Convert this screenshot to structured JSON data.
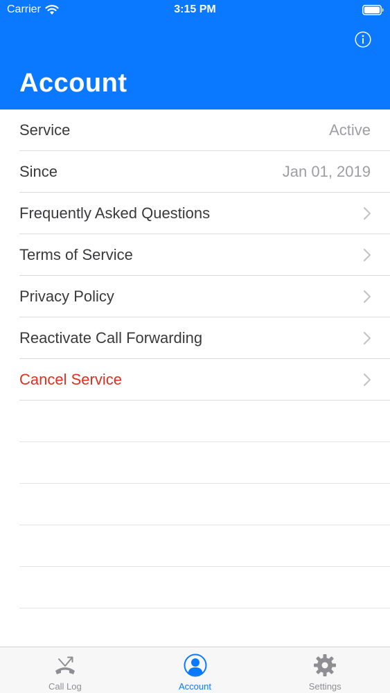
{
  "status_bar": {
    "carrier": "Carrier",
    "time": "3:15 PM"
  },
  "header": {
    "title": "Account",
    "info_icon": "info-icon"
  },
  "rows": [
    {
      "label": "Service",
      "value": "Active"
    },
    {
      "label": "Since",
      "value": "Jan 01, 2019"
    },
    {
      "label": "Frequently Asked Questions"
    },
    {
      "label": "Terms of Service"
    },
    {
      "label": "Privacy Policy"
    },
    {
      "label": "Reactivate Call Forwarding"
    },
    {
      "label": "Cancel Service"
    }
  ],
  "tabs": [
    {
      "label": "Call Log",
      "icon": "call-log-icon"
    },
    {
      "label": "Account",
      "icon": "account-icon",
      "active": true
    },
    {
      "label": "Settings",
      "icon": "gear-icon"
    }
  ],
  "colors": {
    "accent": "#0a78ff",
    "destructive": "#e0301e"
  }
}
